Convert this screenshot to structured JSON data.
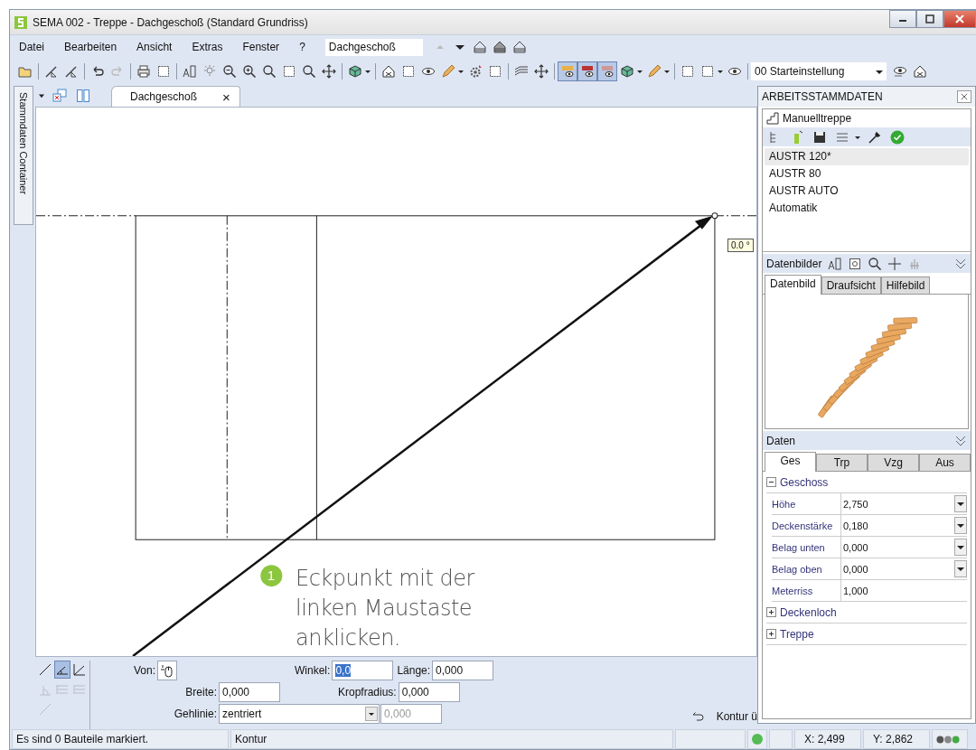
{
  "window": {
    "title": "SEMA  002 - Treppe  - Dachgeschoß (Standard Grundriss)"
  },
  "menu": [
    {
      "label": "Datei"
    },
    {
      "label": "Bearbeiten"
    },
    {
      "label": "Ansicht"
    },
    {
      "label": "Extras"
    },
    {
      "label": "Fenster"
    },
    {
      "label": "?"
    }
  ],
  "floor_select": {
    "value": "Dachgeschoß"
  },
  "toolbar_toggles": [
    {
      "selected": true
    },
    {
      "selected": true
    },
    {
      "selected": true
    }
  ],
  "view_setting": {
    "value": "00 Starteinstellung"
  },
  "side_tab": {
    "label": "Stammdaten Container"
  },
  "document_tab": {
    "label": "Dachgeschoß",
    "close": "×"
  },
  "canvas": {
    "angle_label": "0.0 °"
  },
  "callout": {
    "number": "1",
    "text": "Eckpunkt mit der linken Maustaste anklicken."
  },
  "draw_modes": [
    {
      "selected": false,
      "disabled": false
    },
    {
      "selected": true,
      "disabled": false
    },
    {
      "selected": false,
      "disabled": false
    },
    {
      "selected": false,
      "disabled": true
    },
    {
      "selected": false,
      "disabled": true
    },
    {
      "selected": false,
      "disabled": true
    },
    {
      "selected": false,
      "disabled": true
    }
  ],
  "input_panel": {
    "von_label": "Von:",
    "winkel": {
      "label": "Winkel:",
      "value": "0,0",
      "selected": true
    },
    "laenge": {
      "label": "Länge:",
      "value": "0,000"
    },
    "breite": {
      "label": "Breite:",
      "value": "0,000"
    },
    "kropfradius": {
      "label": "Kropfradius:",
      "value": "0,000"
    },
    "gehlinie": {
      "label": "Gehlinie:",
      "value": "zentriert"
    },
    "offset": {
      "value": "0,000",
      "disabled": true
    },
    "undo_label": "Kontur ü"
  },
  "status_bar": {
    "message": "Es sind 0 Bauteile markiert.",
    "mode": "Kontur",
    "x": "X: 2,499",
    "y": "Y: 2,862"
  },
  "panel": {
    "title": "ARBEITSSTAMMDATEN",
    "type_label": "Manuelltreppe",
    "items": [
      {
        "label": "AUSTR 120*",
        "selected": true
      },
      {
        "label": "AUSTR 80",
        "selected": false
      },
      {
        "label": "AUSTR AUTO",
        "selected": false
      },
      {
        "label": "Automatik",
        "selected": false
      }
    ],
    "images_title": "Datenbilder",
    "image_tabs": [
      {
        "label": "Datenbild",
        "selected": true
      },
      {
        "label": "Draufsicht",
        "selected": false
      },
      {
        "label": "Hilfebild",
        "selected": false
      }
    ],
    "data_title": "Daten",
    "data_tabs": [
      {
        "label": "Ges",
        "selected": true
      },
      {
        "label": "Trp",
        "selected": false
      },
      {
        "label": "Vzg",
        "selected": false
      },
      {
        "label": "Aus",
        "selected": false
      }
    ],
    "groups": [
      {
        "label": "Geschoss",
        "expanded": true,
        "rows": [
          {
            "label": "Höhe",
            "value": "2,750",
            "dropdown": true
          },
          {
            "label": "Deckenstärke",
            "value": "0,180",
            "dropdown": true
          },
          {
            "label": "Belag unten",
            "value": "0,000",
            "dropdown": true
          },
          {
            "label": "Belag oben",
            "value": "0,000",
            "dropdown": true
          },
          {
            "label": "Meterriss",
            "value": "1,000",
            "dropdown": false
          }
        ]
      },
      {
        "label": "Deckenloch",
        "expanded": false
      },
      {
        "label": "Treppe",
        "expanded": false
      }
    ]
  }
}
